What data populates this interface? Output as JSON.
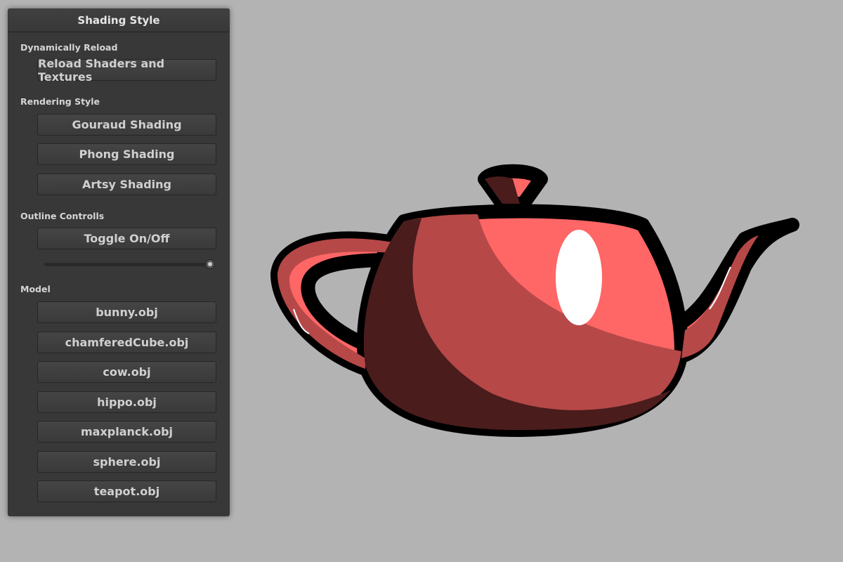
{
  "panel": {
    "title": "Shading Style",
    "sections": {
      "reload": {
        "label": "Dynamically Reload",
        "button": "Reload Shaders and Textures"
      },
      "rendering": {
        "label": "Rendering Style",
        "buttons": [
          "Gouraud Shading",
          "Phong Shading",
          "Artsy Shading"
        ]
      },
      "outline": {
        "label": "Outline Controlls",
        "button": "Toggle On/Off",
        "slider_value": 1.0
      },
      "model": {
        "label": "Model",
        "buttons": [
          "bunny.obj",
          "chamferedCube.obj",
          "cow.obj",
          "hippo.obj",
          "maxplanck.obj",
          "sphere.obj",
          "teapot.obj"
        ]
      }
    }
  },
  "viewport": {
    "model": "teapot",
    "colors": {
      "background": "#b3b3b3",
      "base": "#ff6666",
      "mid": "#b64848",
      "shadow": "#4a1c1c",
      "outline": "#000000",
      "highlight": "#ffffff"
    }
  }
}
